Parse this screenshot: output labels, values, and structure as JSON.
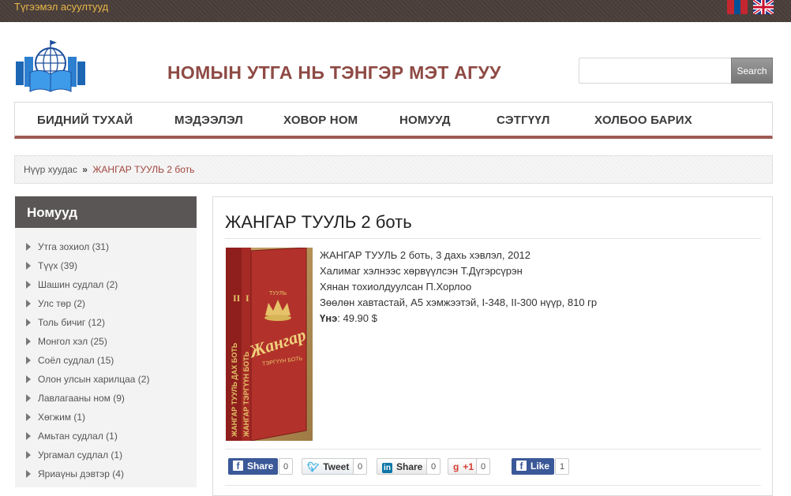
{
  "topbar": {
    "faq_link": "Түгээмэл асуултууд"
  },
  "header": {
    "title": "НОМЫН УТГА НЬ ТЭНГЭР МЭТ АГУУ",
    "search_placeholder": "",
    "search_button": "Search"
  },
  "nav": {
    "items": [
      "БИДНИЙ ТУХАЙ",
      "МЭДЭЭЛЭЛ",
      "ХОВОР НОМ",
      "НОМУУД",
      "СЭТГҮҮЛ",
      "ХОЛБОО БАРИХ"
    ]
  },
  "breadcrumb": {
    "home": "Нүүр хуудас",
    "separator": "»",
    "current": "ЖАНГАР ТУУЛЬ 2 боть"
  },
  "sidebar": {
    "heading": "Номууд",
    "categories": [
      "Утга зохиол (31)",
      "Түүх (39)",
      "Шашин судлал (2)",
      "Улс төр (2)",
      "Толь бичиг (12)",
      "Монгол хэл (25)",
      "Соёл судлал (15)",
      "Олон улсын харилцаа (2)",
      "Лавлагааны ном (9)",
      "Хөгжим (1)",
      "Амьтан судлал (1)",
      "Ургамал судлал (1)",
      "Яриаүны дэвтэр (4)"
    ]
  },
  "book": {
    "title": "ЖАНГАР ТУУЛЬ 2 боть",
    "lines": [
      "ЖАНГАР ТУУЛЬ 2 боть, 3 дахь хэвлэл, 2012",
      "Халимаг хэлнээс хөрвүүлсэн Т.Дүгэрсүрэн",
      "Хянан тохиолдуулсан П.Хорлоо",
      "Зөөлөн хавтастай, А5 хэмжээтэй, I-348, II-300 нүүр, 810 гр"
    ],
    "price_label": "Үнэ",
    "price_value": ": 49.90 $",
    "cover_text": {
      "spine1": "ЖАНГАР ТУУЛЬ ДАХ БОТЬ",
      "spine2": "ЖАНГАР ТЭРГҮҮН БОТЬ",
      "front_top": "ТУУЛЬ",
      "front_title": "Жангар",
      "front_sub": "ТЭРГҮҮН БОТЬ",
      "vol2": "II",
      "vol1": "I"
    }
  },
  "share": {
    "facebook": {
      "label": "Share",
      "count": "0"
    },
    "twitter": {
      "label": "Tweet",
      "count": "0"
    },
    "linkedin": {
      "label": "Share",
      "count": "0"
    },
    "gplus": {
      "label": "+1",
      "count": "0"
    },
    "like": {
      "label": "Like",
      "count": "1"
    }
  },
  "colors": {
    "title": "#8e4a44",
    "accent": "#9e5b53",
    "link": "#a0463e",
    "faq": "#e8b64a",
    "sidebar_head": "#5a5655"
  }
}
